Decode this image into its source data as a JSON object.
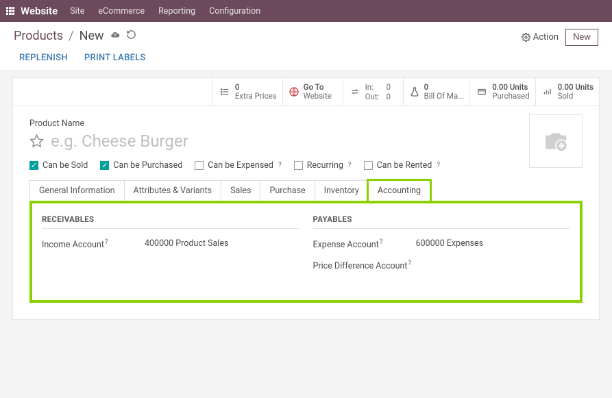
{
  "topnav": {
    "brand": "Website",
    "menu": [
      "Site",
      "eCommerce",
      "Reporting",
      "Configuration"
    ]
  },
  "breadcrumb": {
    "root": "Products",
    "current": "New"
  },
  "actions": {
    "action_label": "Action",
    "new_label": "New"
  },
  "subtabs": {
    "replenish": "REPLENISH",
    "print_labels": "PRINT LABELS"
  },
  "stats": {
    "extra_prices": {
      "count": "0",
      "label": "Extra Prices"
    },
    "goto": {
      "l1": "Go To",
      "l2": "Website"
    },
    "inout": {
      "in_label": "In:",
      "in_val": "0",
      "out_label": "Out:",
      "out_val": "0"
    },
    "bom": {
      "count": "0",
      "label": "Bill Of Ma..."
    },
    "purchased": {
      "count": "0.00 Units",
      "label": "Purchased"
    },
    "sold": {
      "count": "0.00 Units",
      "label": "Sold"
    }
  },
  "product": {
    "name_label": "Product Name",
    "name_placeholder": "e.g. Cheese Burger",
    "checks": {
      "sold": "Can be Sold",
      "purchased": "Can be Purchased",
      "expensed": "Can be Expensed",
      "recurring": "Recurring",
      "rented": "Can be Rented"
    }
  },
  "tabs": [
    "General Information",
    "Attributes & Variants",
    "Sales",
    "Purchase",
    "Inventory",
    "Accounting"
  ],
  "accounting": {
    "receivables_h": "RECEIVABLES",
    "payables_h": "PAYABLES",
    "income_label": "Income Account",
    "income_val": "400000 Product Sales",
    "expense_label": "Expense Account",
    "expense_val": "600000 Expenses",
    "price_diff_label": "Price Difference Account"
  }
}
